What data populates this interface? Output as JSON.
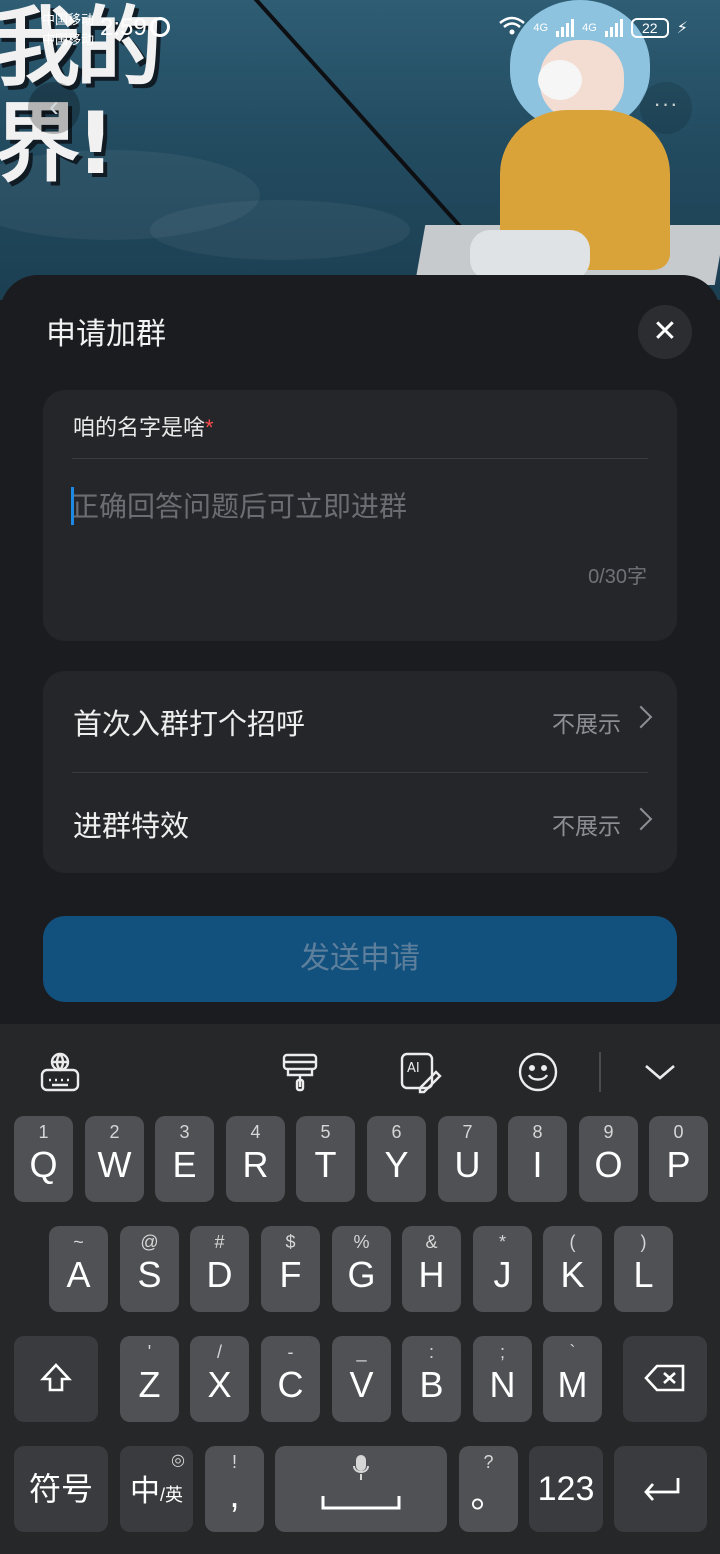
{
  "status": {
    "carrier_1": "中国移动",
    "carrier_2": "中国移动",
    "time": "2:59",
    "net_1": "4G",
    "net_2": "4G",
    "battery": "22"
  },
  "banner": {
    "text": "我的界!"
  },
  "sheet": {
    "title": "申请加群",
    "question": {
      "label": "咱的名字是啥",
      "required_mark": "*",
      "placeholder": "正确回答问题后可立即进群",
      "value": "",
      "counter": "0/30字"
    },
    "options": [
      {
        "label": "首次入群打个招呼",
        "value": "不展示"
      },
      {
        "label": "进群特效",
        "value": "不展示"
      }
    ],
    "submit_label": "发送申请",
    "colors": {
      "accent": "#1e88e5",
      "button_bg": "#12507e",
      "required": "#ff4d4f"
    }
  },
  "keyboard": {
    "toolbar": [
      "globe-keyboard-icon",
      "paintbrush-icon",
      "ai-write-icon",
      "emoji-icon",
      "chevron-down-icon"
    ],
    "row1": [
      {
        "sub": "1",
        "main": "Q"
      },
      {
        "sub": "2",
        "main": "W"
      },
      {
        "sub": "3",
        "main": "E"
      },
      {
        "sub": "4",
        "main": "R"
      },
      {
        "sub": "5",
        "main": "T"
      },
      {
        "sub": "6",
        "main": "Y"
      },
      {
        "sub": "7",
        "main": "U"
      },
      {
        "sub": "8",
        "main": "I"
      },
      {
        "sub": "9",
        "main": "O"
      },
      {
        "sub": "0",
        "main": "P"
      }
    ],
    "row2": [
      {
        "sub": "~",
        "main": "A"
      },
      {
        "sub": "@",
        "main": "S"
      },
      {
        "sub": "#",
        "main": "D"
      },
      {
        "sub": "$",
        "main": "F"
      },
      {
        "sub": "%",
        "main": "G"
      },
      {
        "sub": "&",
        "main": "H"
      },
      {
        "sub": "*",
        "main": "J"
      },
      {
        "sub": "(",
        "main": "K"
      },
      {
        "sub": ")",
        "main": "L"
      }
    ],
    "row3": [
      {
        "sub": "'",
        "main": "Z"
      },
      {
        "sub": "/",
        "main": "X"
      },
      {
        "sub": "-",
        "main": "C"
      },
      {
        "sub": "_",
        "main": "V"
      },
      {
        "sub": ":",
        "main": "B"
      },
      {
        "sub": ";",
        "main": "N"
      },
      {
        "sub": "`",
        "main": "M"
      }
    ],
    "symbols_label": "符号",
    "lang_main": "中",
    "lang_sub": "/英",
    "comma_sub": "!",
    "comma_main": ",",
    "period_sub": "?",
    "period_main": "。",
    "numbers_label": "123"
  }
}
